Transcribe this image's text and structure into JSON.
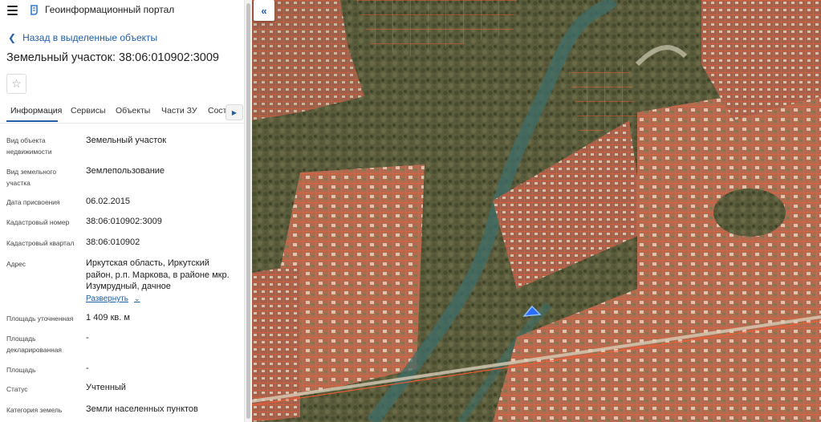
{
  "header": {
    "app_title": "Геоинформационный портал"
  },
  "navigation": {
    "back_label": "Назад в выделенные объекты"
  },
  "page": {
    "title": "Земельный участок: 38:06:010902:3009"
  },
  "tabs": [
    {
      "label": "Информация",
      "active": true
    },
    {
      "label": "Сервисы"
    },
    {
      "label": "Объекты"
    },
    {
      "label": "Части ЗУ"
    },
    {
      "label": "Состав"
    }
  ],
  "info": [
    {
      "label": "Вид объекта недвижимости",
      "value": "Земельный участок"
    },
    {
      "label": "Вид земельного участка",
      "value": "Землепользование"
    },
    {
      "label": "Дата присвоения",
      "value": "06.02.2015"
    },
    {
      "label": "Кадастровый номер",
      "value": "38:06:010902:3009"
    },
    {
      "label": "Кадастровый квартал",
      "value": "38:06:010902"
    },
    {
      "label": "Адрес",
      "value": "Иркутская область, Иркутский район, р.п. Маркова, в районе мкр. Изумрудный, дачное"
    },
    {
      "label": "Площадь уточненная",
      "value": "1 409 кв. м"
    },
    {
      "label": "Площадь декларированная",
      "value": "-"
    },
    {
      "label": "Площадь",
      "value": "-"
    },
    {
      "label": "Статус",
      "value": "Учтенный"
    },
    {
      "label": "Категория земель",
      "value": "Земли населенных пунктов"
    }
  ],
  "address_expand_label": "Развернуть",
  "icons": {
    "menu": "hamburger-icon",
    "logo": "portal-logo-icon",
    "back": "chevron-left-icon",
    "favorite": "star-icon",
    "tabs_more": "chevron-right-icon",
    "expand": "chevron-down-icon",
    "collapse_panel": "double-chevron-left-icon"
  },
  "colors": {
    "accent": "#1f5fa8",
    "parcel_border": "#ff5a2e",
    "selected_parcel": "#2a6cff"
  }
}
